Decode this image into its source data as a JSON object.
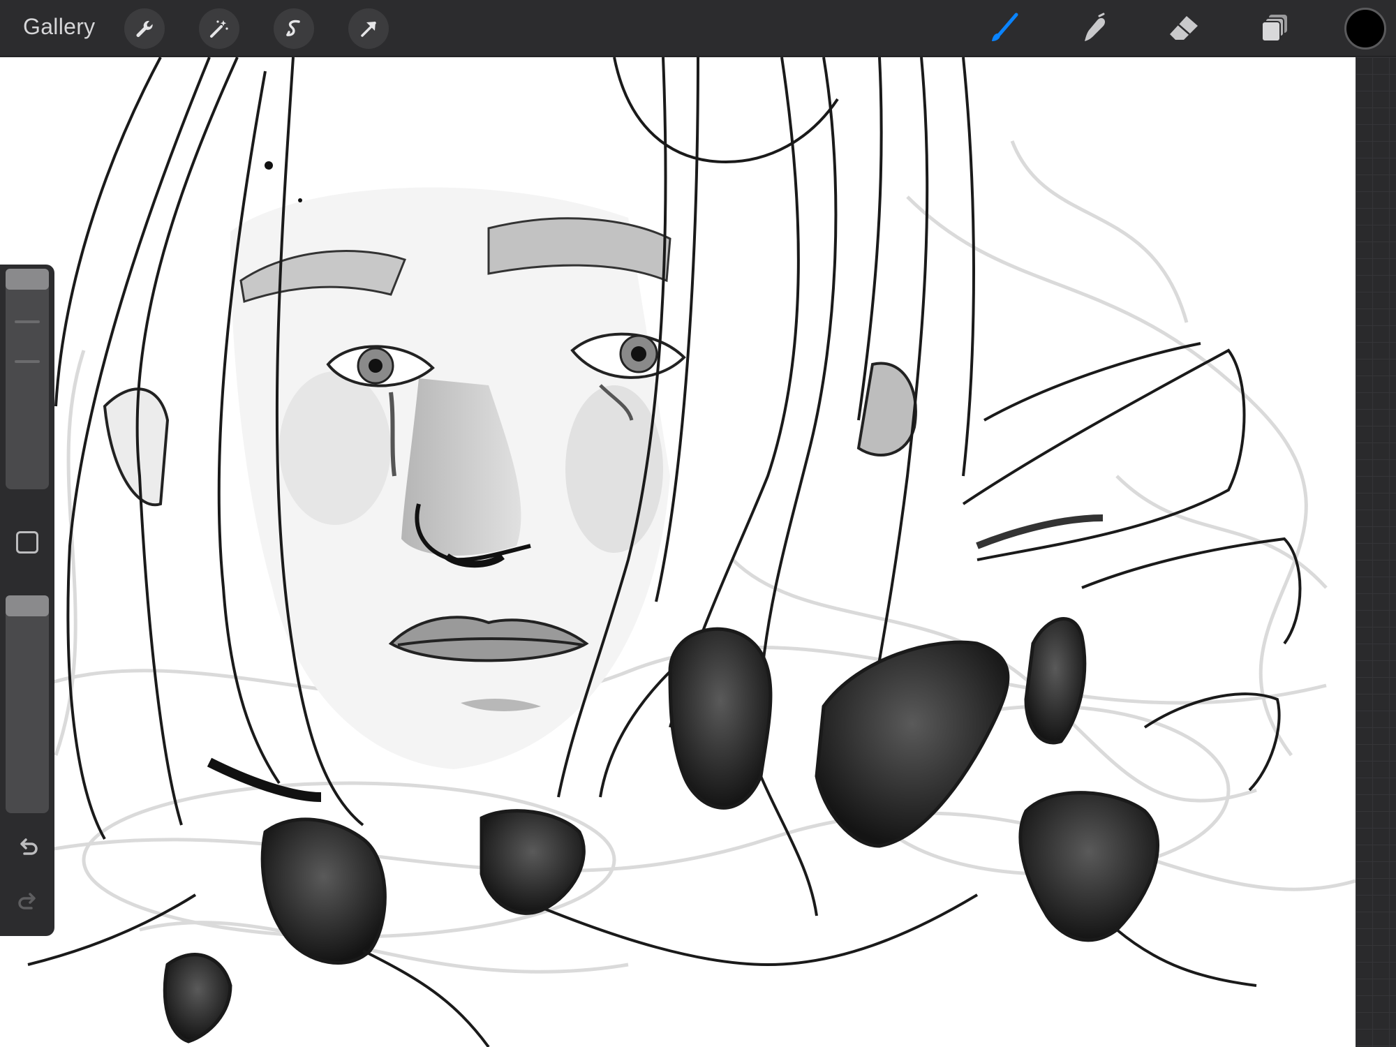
{
  "toolbar": {
    "gallery_label": "Gallery",
    "left_tools": [
      "wrench-icon",
      "magic-wand-icon",
      "selection-icon",
      "transform-arrow-icon"
    ],
    "right_tools": [
      "brush-icon",
      "smudge-icon",
      "eraser-icon",
      "layers-icon"
    ],
    "active_tool": "brush-icon",
    "active_color": "#0a84ff",
    "current_color": "#000000"
  },
  "sidebar": {
    "brush_size_level": 0.0,
    "brush_opacity_level": 0.0,
    "controls": [
      "brush-size-slider",
      "modify-button",
      "opacity-slider",
      "undo-icon",
      "redo-icon"
    ]
  }
}
